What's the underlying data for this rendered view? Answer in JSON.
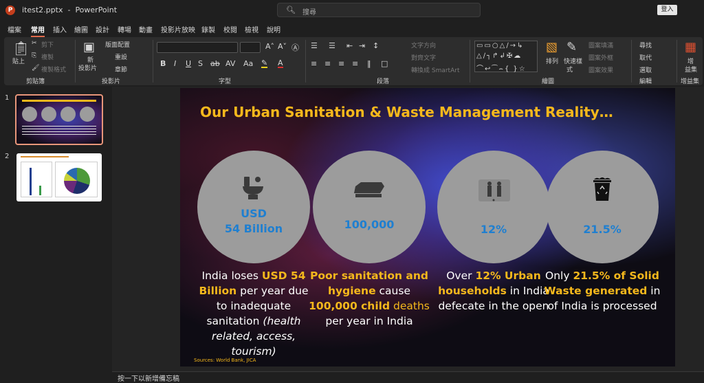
{
  "window": {
    "file_name": "itest2.pptx",
    "app_name": "PowerPoint",
    "search_placeholder": "搜尋",
    "sign_in": "登入"
  },
  "tabs": [
    "檔案",
    "常用",
    "插入",
    "繪圖",
    "設計",
    "轉場",
    "動畫",
    "投影片放映",
    "錄製",
    "校閱",
    "檢視",
    "說明"
  ],
  "active_tab": "常用",
  "ribbon": {
    "clipboard": {
      "paste": "貼上",
      "cut": "剪下",
      "copy": "複製",
      "format_painter": "複製格式",
      "label": "剪貼簿"
    },
    "slides": {
      "new_slide_line1": "新",
      "new_slide_line2": "投影片",
      "layout": "版面配置",
      "reset": "重設",
      "section": "章節",
      "label": "投影片"
    },
    "font": {
      "bold": "B",
      "italic": "I",
      "underline": "U",
      "shadow": "S",
      "strike": "ab",
      "label": "字型"
    },
    "paragraph": {
      "text_direction": "文字方向",
      "align_text": "對齊文字",
      "smartart": "轉換成 SmartArt",
      "label": "段落"
    },
    "drawing": {
      "arrange": "排列",
      "quick_styles_1": "快速樣",
      "quick_styles_2": "式",
      "shape_fill": "圖案填滿",
      "shape_outline": "圖案外框",
      "shape_effects": "圖案效果",
      "label": "繪圖"
    },
    "editing": {
      "find": "尋找",
      "replace": "取代",
      "select": "選取",
      "label": "編輯"
    },
    "addins": {
      "line1": "增",
      "line2": "益集",
      "label": "增益集"
    }
  },
  "thumbnails": [
    "1",
    "2"
  ],
  "slide": {
    "title": "Our Urban Sanitation & Waste Management Reality…",
    "circles": [
      {
        "line1": "USD",
        "line2": "54 Billion"
      },
      {
        "value": "100,000"
      },
      {
        "value": "12%"
      },
      {
        "value": "21.5%"
      }
    ],
    "desc1": {
      "a": "India loses ",
      "b": "USD 54 Billion",
      "c": " per year due to inadequate sanitation ",
      "d": "(health related, access, tourism)"
    },
    "desc2": {
      "a": "Poor sanitation and hygiene",
      "b": " cause ",
      "c": "100,000 child",
      "d": " deaths",
      "e": " per year in India"
    },
    "desc3": {
      "a": "Over ",
      "b": "12% Urban households",
      "c": " in India defecate in the open"
    },
    "desc4": {
      "a": "Only ",
      "b": "21.5% of Solid Waste generated",
      "c": " in of India is processed"
    },
    "sources": "Sources: World Bank, JICA"
  },
  "notes_placeholder": "按一下以新增備忘稿",
  "colors": {
    "accent": "#f5b81c",
    "value_blue": "#1f7fd0",
    "circle_gray": "#9c9c9c"
  }
}
